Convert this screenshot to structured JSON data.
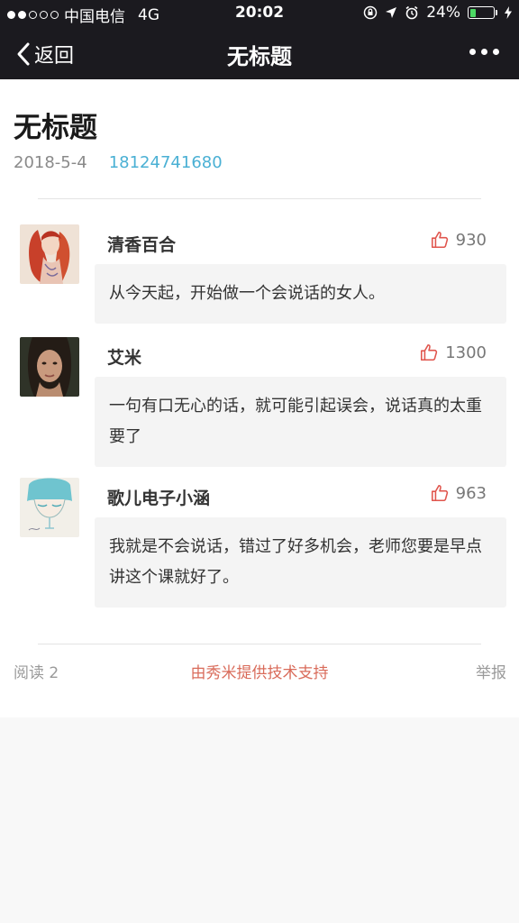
{
  "status_bar": {
    "carrier": "中国电信",
    "network": "4G",
    "time": "20:02",
    "battery": "24%",
    "battery_level": 0.24,
    "signal_bars_filled": 2,
    "signal_bars_total": 5
  },
  "nav": {
    "back_label": "返回",
    "title": "无标题"
  },
  "article": {
    "title": "无标题",
    "date": "2018-5-4",
    "author_link": "18124741680"
  },
  "comments": [
    {
      "name": "清香百合",
      "likes": "930",
      "text": "从今天起，开始做一个会说话的女人。"
    },
    {
      "name": "艾米",
      "likes": "1300",
      "text": "一句有口无心的话，就可能引起误会，说话真的太重要了"
    },
    {
      "name": "歌儿电子小涵",
      "likes": "963",
      "text": "我就是不会说话，错过了好多机会，老师您要是早点讲这个课就好了。"
    }
  ],
  "footer": {
    "read_count": "阅读 2",
    "support": "由秀米提供技术支持",
    "report": "举报"
  },
  "colors": {
    "bar": "#1b1a1f",
    "link": "#4ab0d4",
    "like_icon": "#e0554d",
    "support": "#d96b5a",
    "battery_fill": "#4cd964"
  }
}
